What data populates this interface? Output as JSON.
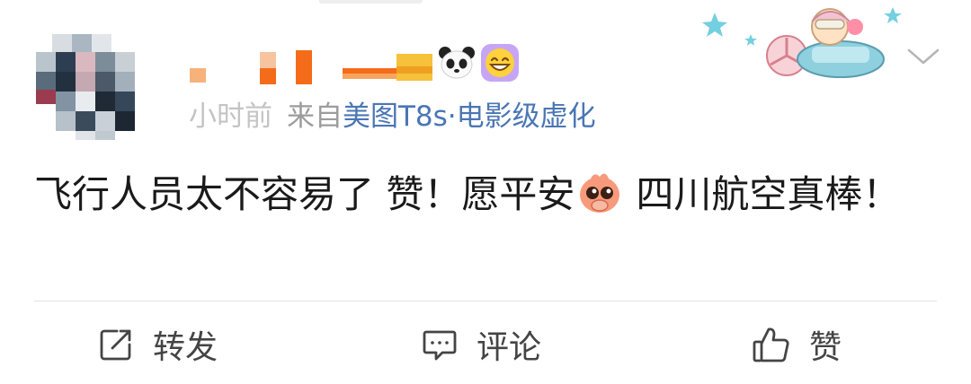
{
  "post": {
    "meta": {
      "time": "小时前",
      "from_label": "来自",
      "device": "美图T8s·电影级虚化"
    },
    "content": {
      "text_part1": "飞行人员太不容易了 赞！愿平安",
      "text_part2": "四川航空真棒！",
      "emoji_inline": "shy-face-emoji"
    },
    "actions": {
      "repost_label": "转发",
      "comment_label": "评论",
      "like_label": "赞"
    },
    "icons": {
      "repost": "share-icon",
      "comment": "comment-icon",
      "like": "thumbs-up-icon",
      "menu": "chevron-down-icon"
    },
    "colors": {
      "link": "#4a76b4",
      "meta": "#9c9c9c",
      "text": "#1a1a1a",
      "name_orange": "#f46c1a"
    }
  }
}
